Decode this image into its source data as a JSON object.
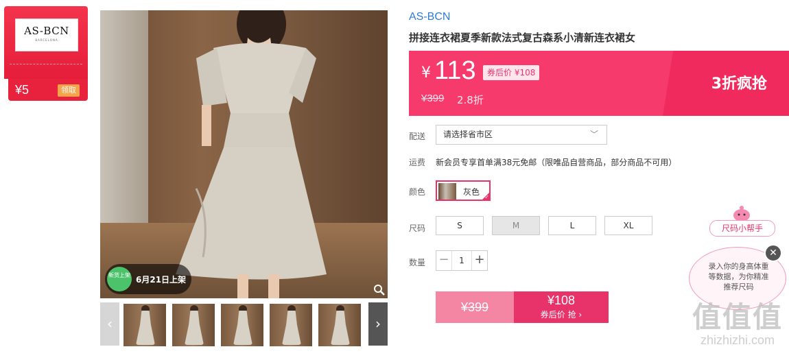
{
  "coupon": {
    "logo_text": "AS-BCN",
    "logo_sub": "BARCELONA",
    "amount": "¥5",
    "claim": "领取"
  },
  "gallery": {
    "badge_circle": "新货上架",
    "badge_date": "6月21日上架",
    "prev": "‹",
    "next": "›"
  },
  "product": {
    "brand": "AS-BCN",
    "title": "拼接连衣裙夏季新款法式复古森系小清新连衣裙女"
  },
  "price": {
    "currency": "¥",
    "current": "113",
    "after_coupon": "券后价 ¥108",
    "original": "¥399",
    "discount": "2.8折",
    "promo": "3折疯抢",
    "accent": "#f63a6c"
  },
  "delivery": {
    "label": "配送",
    "placeholder": "请选择省市区"
  },
  "shipping": {
    "label": "运费",
    "text": "新会员专享首单满38元免邮（限唯品自营商品，部分商品不可用）"
  },
  "color": {
    "label": "颜色",
    "option": "灰色"
  },
  "size": {
    "label": "尺码",
    "options": [
      "S",
      "M",
      "L",
      "XL"
    ],
    "disabled": "M"
  },
  "quantity": {
    "label": "数量",
    "value": "1"
  },
  "buy": {
    "original": "¥399",
    "price": "¥108",
    "cta": "券后价 抢 ›"
  },
  "size_helper": {
    "pill": "尺码小帮手",
    "text": "录入你的身高体重等数据，为你精准推荐尺码",
    "close": "✕"
  },
  "watermark": {
    "chars": "值值值",
    "url": "zhizhizhi.com"
  }
}
